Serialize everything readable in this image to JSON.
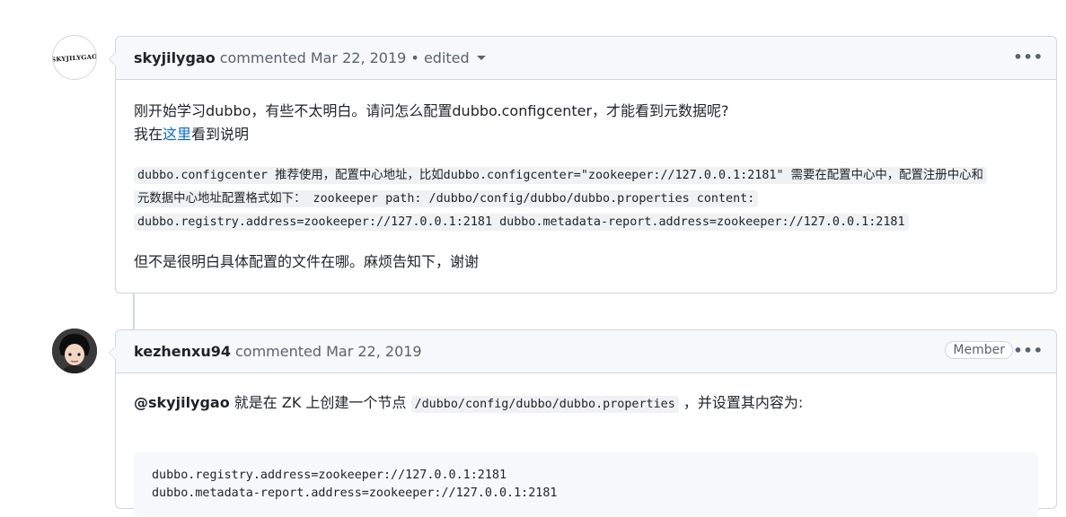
{
  "comments": [
    {
      "avatar_text": "SKYJILYGAO",
      "author": "skyjilygao",
      "meta": "commented Mar 22, 2019 • edited",
      "more_label": "•••",
      "body": {
        "line1": "刚开始学习dubbo，有些不太明白。请问怎么配置dubbo.configcenter，才能看到元数据呢?",
        "line2_prefix": "我在",
        "line2_link": "这里",
        "line2_suffix": "看到说明",
        "quote_line1": "dubbo.configcenter 推荐使用，配置中心地址，比如dubbo.configcenter=\"zookeeper://127.0.0.1:2181\" 需要在配置中心中，配置注册中心和",
        "quote_line2": "元数据中心地址配置格式如下： zookeeper path: /dubbo/config/dubbo/dubbo.properties content:",
        "quote_line3": "dubbo.registry.address=zookeeper://127.0.0.1:2181 dubbo.metadata-report.address=zookeeper://127.0.0.1:2181",
        "line_last": "但不是很明白具体配置的文件在哪。麻烦告知下，谢谢"
      }
    },
    {
      "author": "kezhenxu94",
      "meta": "commented Mar 22, 2019",
      "badge": "Member",
      "more_label": "•••",
      "body": {
        "mention": "@skyjilygao",
        "text_before_code": " 就是在 ZK 上创建一个节点 ",
        "inline_code": "/dubbo/config/dubbo/dubbo.properties",
        "text_after_code": " ，并设置其内容为:",
        "code_line1": "dubbo.registry.address=zookeeper://127.0.0.1:2181",
        "code_line2": "dubbo.metadata-report.address=zookeeper://127.0.0.1:2181"
      }
    }
  ]
}
